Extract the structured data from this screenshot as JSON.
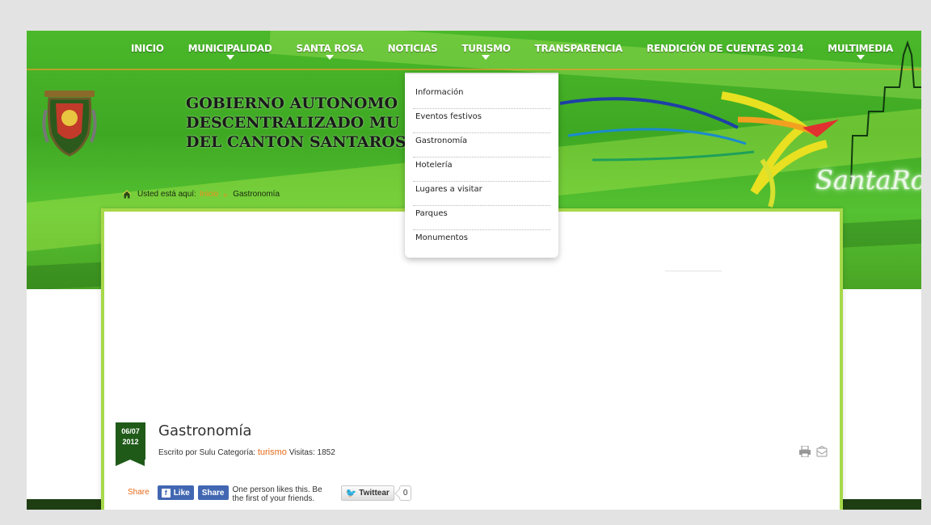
{
  "nav": {
    "items": [
      {
        "label": "INICIO",
        "has_submenu": false
      },
      {
        "label": "MUNICIPALIDAD",
        "has_submenu": true
      },
      {
        "label": "SANTA ROSA",
        "has_submenu": true
      },
      {
        "label": "NOTICIAS",
        "has_submenu": false
      },
      {
        "label": "TURISMO",
        "has_submenu": true,
        "active": true
      },
      {
        "label": "TRANSPARENCIA",
        "has_submenu": false
      },
      {
        "label": "RENDICIÓN DE CUENTAS 2014",
        "has_submenu": false
      },
      {
        "label": "MULTIMEDIA",
        "has_submenu": true
      }
    ]
  },
  "header": {
    "title_lines": [
      "GOBIERNO AUTONOMO",
      "DESCENTRALIZADO MU",
      "DEL CANTON SANTAROS"
    ],
    "script_text": "SantaRosa"
  },
  "dropdown": {
    "items": [
      "Información",
      "Eventos festivos",
      "Gastronomía",
      "Hotelería",
      "Lugares a visitar",
      "Parques",
      "Monumentos"
    ]
  },
  "breadcrumb": {
    "prefix": "Usted está aquí:",
    "home": "Inicio",
    "separator": "»",
    "current": "Gastronomía"
  },
  "article": {
    "date_day": "06/07",
    "date_year": "2012",
    "title": "Gastronomía",
    "meta_prefix": "Escrito por Sulu Categoría:",
    "category": "turismo",
    "visits_label": "Visitas: 1852"
  },
  "share": {
    "label": "Share",
    "fb_like": "Like",
    "fb_share": "Share",
    "fb_text": "One person likes this. Be the first of your friends.",
    "tweet": "Twittear",
    "tweet_count": "0"
  },
  "colors": {
    "banner_green": "#3ea823",
    "accent_orange": "#e56a1b",
    "date_badge": "#1f5a19",
    "card_border": "#a6d94a"
  }
}
